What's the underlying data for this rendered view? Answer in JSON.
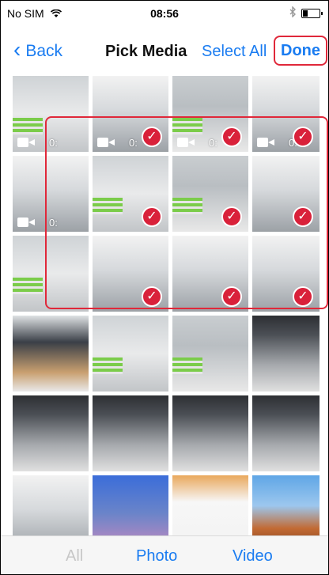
{
  "status": {
    "carrier": "No SIM",
    "wifi_icon": "wifi-icon",
    "time": "08:56",
    "bluetooth_icon": "bluetooth-icon",
    "battery_level": 0.35
  },
  "nav": {
    "back_label": "Back",
    "title": "Pick Media",
    "select_all_label": "Select All",
    "done_label": "Done"
  },
  "accent_color": "#1a7cf1",
  "highlight_color": "#e0283a",
  "thumbnails": [
    {
      "type": "video",
      "duration": "0:",
      "selected": false,
      "scene": "lobby"
    },
    {
      "type": "video",
      "duration": "0:",
      "selected": true,
      "scene": "corridor"
    },
    {
      "type": "video",
      "duration": "0:",
      "selected": true,
      "scene": "office"
    },
    {
      "type": "video",
      "duration": "0:",
      "selected": true,
      "scene": "corridor"
    },
    {
      "type": "video",
      "duration": "0:",
      "selected": false,
      "scene": "corridor"
    },
    {
      "type": "photo",
      "duration": "",
      "selected": true,
      "scene": "lobby"
    },
    {
      "type": "photo",
      "duration": "",
      "selected": true,
      "scene": "office"
    },
    {
      "type": "photo",
      "duration": "",
      "selected": true,
      "scene": "corridor"
    },
    {
      "type": "photo",
      "duration": "",
      "selected": false,
      "scene": "lobby"
    },
    {
      "type": "photo",
      "duration": "",
      "selected": true,
      "scene": "corridor"
    },
    {
      "type": "photo",
      "duration": "",
      "selected": true,
      "scene": "corridor"
    },
    {
      "type": "photo",
      "duration": "",
      "selected": true,
      "scene": "corridor"
    },
    {
      "type": "photo",
      "duration": "",
      "selected": false,
      "scene": "reception"
    },
    {
      "type": "photo",
      "duration": "",
      "selected": false,
      "scene": "lobby"
    },
    {
      "type": "photo",
      "duration": "",
      "selected": false,
      "scene": "office"
    },
    {
      "type": "photo",
      "duration": "",
      "selected": false,
      "scene": "dark-corridor"
    },
    {
      "type": "photo",
      "duration": "",
      "selected": false,
      "scene": "dark-corridor"
    },
    {
      "type": "photo",
      "duration": "",
      "selected": false,
      "scene": "dark-corridor"
    },
    {
      "type": "photo",
      "duration": "",
      "selected": false,
      "scene": "dark-corridor"
    },
    {
      "type": "photo",
      "duration": "",
      "selected": false,
      "scene": "dark-corridor"
    },
    {
      "type": "photo",
      "duration": "",
      "selected": false,
      "scene": "corridor"
    },
    {
      "type": "photo",
      "duration": "",
      "selected": false,
      "scene": "homescreen"
    },
    {
      "type": "photo",
      "duration": "",
      "selected": false,
      "scene": "appstore"
    },
    {
      "type": "photo",
      "duration": "",
      "selected": false,
      "scene": "arch"
    }
  ],
  "tabs": {
    "all_label": "All",
    "photo_label": "Photo",
    "video_label": "Video"
  }
}
